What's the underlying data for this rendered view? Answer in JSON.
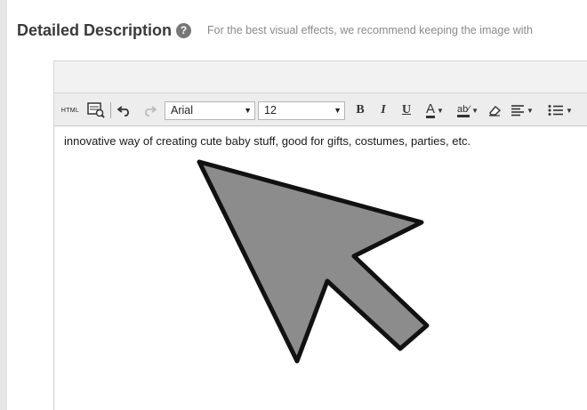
{
  "header": {
    "title": "Detailed Description",
    "help_icon_glyph": "?",
    "hint": "For the best visual effects, we recommend keeping the image with"
  },
  "toolbar": {
    "html_label": "HTML",
    "font": "Arial",
    "size": "12",
    "bold": "B",
    "italic": "I",
    "underline": "U",
    "text_color": "A",
    "highlight": "ab⁄",
    "icons": [
      "html-icon",
      "preview-icon",
      "undo-icon",
      "redo-icon",
      "bold-icon",
      "italic-icon",
      "underline-icon",
      "text-color-icon",
      "highlight-icon",
      "eraser-icon",
      "align-icon",
      "list-icon"
    ]
  },
  "editor": {
    "text": "innovative way of creating cute baby stuff, good for gifts, costumes, parties, etc."
  },
  "colors": {
    "cursor_fill": "#8c8c8c",
    "cursor_stroke": "#111111"
  }
}
